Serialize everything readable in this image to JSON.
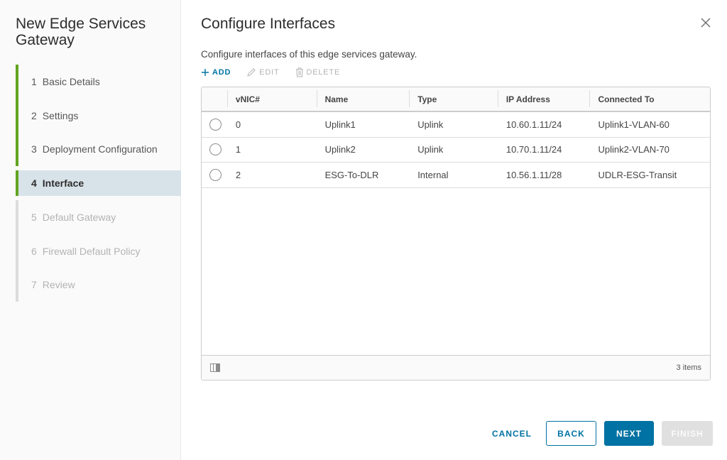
{
  "sidebar": {
    "title": "New Edge Services Gateway",
    "steps": [
      {
        "num": "1",
        "label": "Basic Details",
        "state": "done"
      },
      {
        "num": "2",
        "label": "Settings",
        "state": "done"
      },
      {
        "num": "3",
        "label": "Deployment Configuration",
        "state": "done"
      },
      {
        "num": "4",
        "label": "Interface",
        "state": "current"
      },
      {
        "num": "5",
        "label": "Default Gateway",
        "state": "pending"
      },
      {
        "num": "6",
        "label": "Firewall Default Policy",
        "state": "pending"
      },
      {
        "num": "7",
        "label": "Review",
        "state": "pending"
      }
    ]
  },
  "main": {
    "title": "Configure Interfaces",
    "description": "Configure interfaces of this edge services gateway.",
    "toolbar": {
      "add": "ADD",
      "edit": "EDIT",
      "delete": "DELETE"
    },
    "grid": {
      "columns": [
        "vNIC#",
        "Name",
        "Type",
        "IP Address",
        "Connected To"
      ],
      "rows": [
        {
          "vnic": "0",
          "name": "Uplink1",
          "type": "Uplink",
          "ip": "10.60.1.11/24",
          "connected": "Uplink1-VLAN-60"
        },
        {
          "vnic": "1",
          "name": "Uplink2",
          "type": "Uplink",
          "ip": "10.70.1.11/24",
          "connected": "Uplink2-VLAN-70"
        },
        {
          "vnic": "2",
          "name": "ESG-To-DLR",
          "type": "Internal",
          "ip": "10.56.1.11/28",
          "connected": "UDLR-ESG-Transit"
        }
      ],
      "footer_count": "3 items"
    }
  },
  "buttons": {
    "cancel": "CANCEL",
    "back": "BACK",
    "next": "NEXT",
    "finish": "FINISH"
  },
  "colors": {
    "accent": "#0072a3",
    "step_done": "#62a420",
    "step_current_bg": "#d8e3e9"
  },
  "icons": {
    "close": "close-icon",
    "add": "plus-icon",
    "edit": "pencil-icon",
    "delete": "trash-icon",
    "column_toggle": "column-toggle-icon"
  }
}
